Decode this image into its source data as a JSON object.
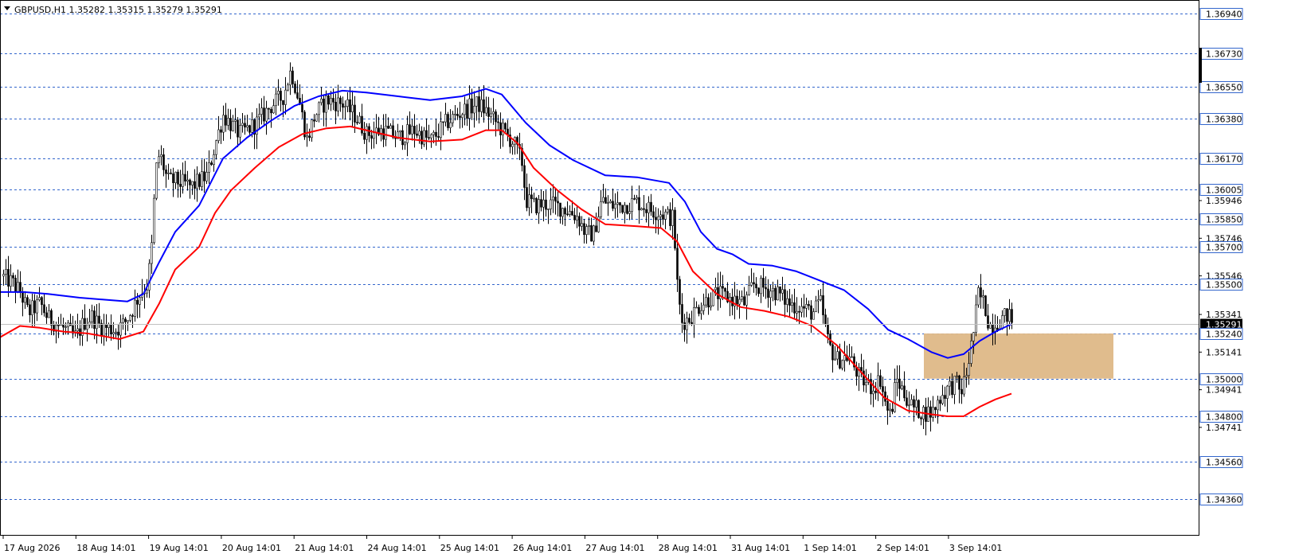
{
  "header": {
    "symbol_line": "GBPUSD,H1  1.35282 1.35315 1.35279 1.35291"
  },
  "colors": {
    "background": "#ffffff",
    "candle": "#000000",
    "ma_fast": "#0000ff",
    "ma_slow": "#ff0000",
    "level_line": "#3366cc",
    "zone_fill": "#deb887",
    "current_price_box": "#000000"
  },
  "chart_data": {
    "type": "candlestick",
    "symbol": "GBPUSD",
    "timeframe": "H1",
    "last_bar": {
      "open": 1.35282,
      "high": 1.35315,
      "low": 1.35279,
      "close": 1.35291
    },
    "ylim": [
      1.3428,
      1.3701
    ],
    "y_ticks": [
      "1.35946",
      "1.35746",
      "1.35546",
      "1.35341",
      "1.35141",
      "1.34941",
      "1.34741"
    ],
    "x_ticks": [
      "17 Aug 2026",
      "18 Aug 14:01",
      "19 Aug 14:01",
      "20 Aug 14:01",
      "21 Aug 14:01",
      "24 Aug 14:01",
      "25 Aug 14:01",
      "26 Aug 14:01",
      "27 Aug 14:01",
      "28 Aug 14:01",
      "31 Aug 14:01",
      "1 Sep 14:01",
      "2 Sep 14:01",
      "3 Sep 14:01"
    ],
    "horizontal_levels": [
      "1.36940",
      "1.36730",
      "1.36550",
      "1.36380",
      "1.36170",
      "1.36005",
      "1.35850",
      "1.35700",
      "1.35500",
      "1.35240",
      "1.35000",
      "1.34800",
      "1.34560",
      "1.34360"
    ],
    "current_price": "1.35291",
    "grid": false,
    "price_path": [
      [
        0,
        1.3555
      ],
      [
        15,
        1.3551
      ],
      [
        25,
        1.3546
      ],
      [
        35,
        1.3535
      ],
      [
        50,
        1.354
      ],
      [
        60,
        1.3532
      ],
      [
        75,
        1.3528
      ],
      [
        85,
        1.3525
      ],
      [
        95,
        1.3522
      ],
      [
        105,
        1.353
      ],
      [
        115,
        1.3533
      ],
      [
        125,
        1.3528
      ],
      [
        135,
        1.3527
      ],
      [
        145,
        1.3526
      ],
      [
        155,
        1.3529
      ],
      [
        165,
        1.3536
      ],
      [
        175,
        1.3545
      ],
      [
        185,
        1.355
      ],
      [
        190,
        1.357
      ],
      [
        195,
        1.361
      ],
      [
        200,
        1.362
      ],
      [
        210,
        1.3605
      ],
      [
        220,
        1.3605
      ],
      [
        240,
        1.3602
      ],
      [
        260,
        1.3608
      ],
      [
        270,
        1.3625
      ],
      [
        280,
        1.364
      ],
      [
        300,
        1.363
      ],
      [
        320,
        1.3635
      ],
      [
        340,
        1.3645
      ],
      [
        355,
        1.365
      ],
      [
        365,
        1.3664
      ],
      [
        375,
        1.3648
      ],
      [
        385,
        1.3627
      ],
      [
        395,
        1.364
      ],
      [
        410,
        1.3648
      ],
      [
        430,
        1.3646
      ],
      [
        445,
        1.364
      ],
      [
        460,
        1.363
      ],
      [
        480,
        1.3632
      ],
      [
        500,
        1.3628
      ],
      [
        520,
        1.3632
      ],
      [
        540,
        1.3626
      ],
      [
        560,
        1.3636
      ],
      [
        580,
        1.3642
      ],
      [
        600,
        1.3646
      ],
      [
        615,
        1.364
      ],
      [
        630,
        1.3632
      ],
      [
        645,
        1.3625
      ],
      [
        655,
        1.3615
      ],
      [
        660,
        1.3595
      ],
      [
        670,
        1.3592
      ],
      [
        690,
        1.3593
      ],
      [
        710,
        1.359
      ],
      [
        725,
        1.3586
      ],
      [
        735,
        1.3577
      ],
      [
        745,
        1.3577
      ],
      [
        755,
        1.3595
      ],
      [
        765,
        1.3592
      ],
      [
        780,
        1.3592
      ],
      [
        800,
        1.3594
      ],
      [
        815,
        1.359
      ],
      [
        830,
        1.3588
      ],
      [
        845,
        1.3585
      ],
      [
        850,
        1.355
      ],
      [
        855,
        1.353
      ],
      [
        865,
        1.3532
      ],
      [
        880,
        1.354
      ],
      [
        900,
        1.3545
      ],
      [
        920,
        1.3542
      ],
      [
        935,
        1.354
      ],
      [
        945,
        1.355
      ],
      [
        960,
        1.3548
      ],
      [
        975,
        1.3546
      ],
      [
        990,
        1.354
      ],
      [
        1005,
        1.3538
      ],
      [
        1020,
        1.3535
      ],
      [
        1030,
        1.354
      ],
      [
        1040,
        1.3518
      ],
      [
        1050,
        1.351
      ],
      [
        1065,
        1.3512
      ],
      [
        1080,
        1.35
      ],
      [
        1095,
        1.3495
      ],
      [
        1105,
        1.35
      ],
      [
        1112,
        1.3485
      ],
      [
        1118,
        1.348
      ],
      [
        1125,
        1.35
      ],
      [
        1135,
        1.3492
      ],
      [
        1145,
        1.3485
      ],
      [
        1160,
        1.3482
      ],
      [
        1170,
        1.3482
      ],
      [
        1180,
        1.349
      ],
      [
        1190,
        1.3495
      ],
      [
        1200,
        1.3498
      ],
      [
        1205,
        1.3492
      ],
      [
        1212,
        1.35
      ],
      [
        1218,
        1.3515
      ],
      [
        1222,
        1.3525
      ],
      [
        1228,
        1.3545
      ],
      [
        1235,
        1.354
      ],
      [
        1242,
        1.3528
      ],
      [
        1250,
        1.353
      ],
      [
        1258,
        1.3532
      ],
      [
        1266,
        1.3534
      ],
      [
        1272,
        1.3529
      ]
    ],
    "series": [
      {
        "values": [
          [
            0,
            1.3546
          ],
          [
            30,
            1.3546
          ],
          [
            60,
            1.3545
          ],
          [
            100,
            1.3543
          ],
          [
            130,
            1.3542
          ],
          [
            160,
            1.3541
          ],
          [
            180,
            1.3545
          ],
          [
            200,
            1.3562
          ],
          [
            220,
            1.3578
          ],
          [
            250,
            1.3592
          ],
          [
            280,
            1.3617
          ],
          [
            310,
            1.3628
          ],
          [
            340,
            1.3637
          ],
          [
            370,
            1.3645
          ],
          [
            400,
            1.365
          ],
          [
            430,
            1.3653
          ],
          [
            460,
            1.3652
          ],
          [
            500,
            1.365
          ],
          [
            540,
            1.3648
          ],
          [
            580,
            1.365
          ],
          [
            610,
            1.3654
          ],
          [
            630,
            1.3651
          ],
          [
            660,
            1.3636
          ],
          [
            690,
            1.3624
          ],
          [
            720,
            1.3616
          ],
          [
            760,
            1.3608
          ],
          [
            800,
            1.3607
          ],
          [
            840,
            1.3604
          ],
          [
            860,
            1.3594
          ],
          [
            880,
            1.3578
          ],
          [
            900,
            1.3569
          ],
          [
            920,
            1.3566
          ],
          [
            940,
            1.3561
          ],
          [
            970,
            1.356
          ],
          [
            1000,
            1.3557
          ],
          [
            1030,
            1.3552
          ],
          [
            1060,
            1.3547
          ],
          [
            1090,
            1.3537
          ],
          [
            1115,
            1.3526
          ],
          [
            1140,
            1.3521
          ],
          [
            1170,
            1.3514
          ],
          [
            1190,
            1.3511
          ],
          [
            1210,
            1.3513
          ],
          [
            1230,
            1.352
          ],
          [
            1250,
            1.3525
          ],
          [
            1270,
            1.3529
          ]
        ]
      },
      {
        "values": [
          [
            0,
            1.3522
          ],
          [
            25,
            1.3528
          ],
          [
            50,
            1.3527
          ],
          [
            80,
            1.3525
          ],
          [
            110,
            1.3524
          ],
          [
            150,
            1.3521
          ],
          [
            180,
            1.3525
          ],
          [
            200,
            1.354
          ],
          [
            220,
            1.3558
          ],
          [
            250,
            1.357
          ],
          [
            270,
            1.3588
          ],
          [
            290,
            1.36
          ],
          [
            320,
            1.3612
          ],
          [
            350,
            1.3623
          ],
          [
            380,
            1.363
          ],
          [
            410,
            1.3633
          ],
          [
            440,
            1.3634
          ],
          [
            470,
            1.3631
          ],
          [
            500,
            1.3628
          ],
          [
            540,
            1.3626
          ],
          [
            580,
            1.3627
          ],
          [
            610,
            1.3632
          ],
          [
            630,
            1.3632
          ],
          [
            650,
            1.3625
          ],
          [
            670,
            1.3612
          ],
          [
            700,
            1.36
          ],
          [
            730,
            1.359
          ],
          [
            760,
            1.3582
          ],
          [
            800,
            1.3581
          ],
          [
            830,
            1.358
          ],
          [
            850,
            1.3573
          ],
          [
            870,
            1.3557
          ],
          [
            900,
            1.3545
          ],
          [
            930,
            1.3538
          ],
          [
            960,
            1.3536
          ],
          [
            990,
            1.3533
          ],
          [
            1020,
            1.3528
          ],
          [
            1050,
            1.3518
          ],
          [
            1080,
            1.3504
          ],
          [
            1110,
            1.349
          ],
          [
            1140,
            1.3483
          ],
          [
            1170,
            1.3481
          ],
          [
            1190,
            1.348
          ],
          [
            1210,
            1.348
          ],
          [
            1230,
            1.3485
          ],
          [
            1250,
            1.3489
          ],
          [
            1270,
            1.3492
          ]
        ]
      }
    ],
    "zone": {
      "x_from": 1160,
      "x_to": 1398,
      "price_low": 1.35,
      "price_high": 1.3524
    }
  }
}
